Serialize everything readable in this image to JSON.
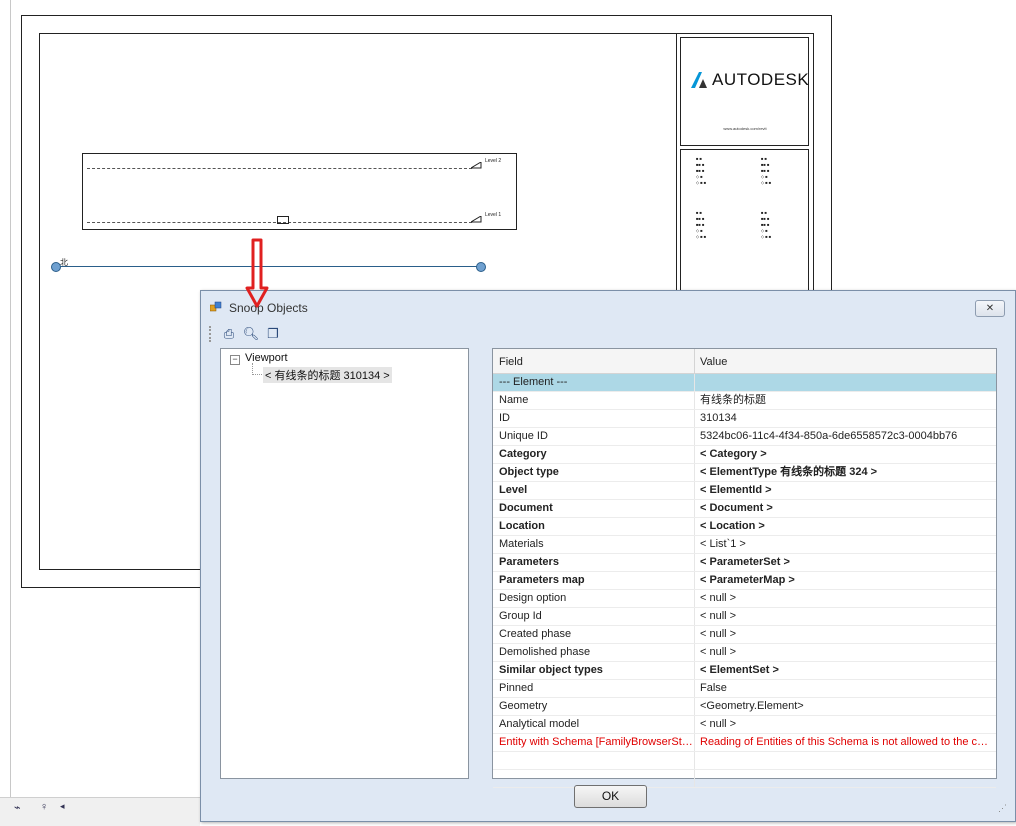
{
  "background": {
    "logo_text": "AUTODESK",
    "logo_url": "www.autodesk.com/revit",
    "grid_label": "北",
    "level_top": "Level 2",
    "level_bottom": "Level 1"
  },
  "dialog": {
    "title": "Snoop Objects",
    "close_label": "✕",
    "ok_label": "OK",
    "tree": {
      "root": "Viewport",
      "child": "< 有线条的标题  310134 >"
    },
    "grid": {
      "columns": [
        "Field",
        "Value"
      ],
      "rows": [
        {
          "field": "--- Element ---",
          "value": "",
          "style": "section"
        },
        {
          "field": "Name",
          "value": "有线条的标题",
          "style": "normal"
        },
        {
          "field": "ID",
          "value": "310134",
          "style": "normal"
        },
        {
          "field": "Unique ID",
          "value": "5324bc06-11c4-4f34-850a-6de6558572c3-0004bb76",
          "style": "normal"
        },
        {
          "field": "Category",
          "value": "< Category >",
          "style": "bold"
        },
        {
          "field": "Object type",
          "value": "< ElementType  有线条的标题    324 >",
          "style": "bold"
        },
        {
          "field": "Level",
          "value": "< ElementId >",
          "style": "bold"
        },
        {
          "field": "Document",
          "value": "< Document >",
          "style": "bold"
        },
        {
          "field": "Location",
          "value": "< Location >",
          "style": "bold"
        },
        {
          "field": "Materials",
          "value": "< List`1 >",
          "style": "normal"
        },
        {
          "field": "Parameters",
          "value": "< ParameterSet >",
          "style": "bold"
        },
        {
          "field": "Parameters map",
          "value": "< ParameterMap >",
          "style": "bold"
        },
        {
          "field": "Design option",
          "value": "< null >",
          "style": "normal"
        },
        {
          "field": "Group Id",
          "value": "< null >",
          "style": "normal"
        },
        {
          "field": "Created phase",
          "value": "< null >",
          "style": "normal"
        },
        {
          "field": "Demolished phase",
          "value": "< null >",
          "style": "normal"
        },
        {
          "field": "Similar object types",
          "value": "< ElementSet >",
          "style": "bold"
        },
        {
          "field": "Pinned",
          "value": "False",
          "style": "normal"
        },
        {
          "field": "Geometry",
          "value": "<Geometry.Element>",
          "style": "normal"
        },
        {
          "field": "Analytical model",
          "value": "< null >",
          "style": "normal"
        },
        {
          "field": "Entity with Schema [FamilyBrowserStat...",
          "value": "Reading of Entities of this Schema is not allowed to the cur...",
          "style": "error"
        },
        {
          "field": "",
          "value": "",
          "style": "normal"
        },
        {
          "field": "",
          "value": "",
          "style": "normal"
        }
      ]
    }
  },
  "colors": {
    "section_row": "#add8e6",
    "error_text": "#e00000",
    "arrow": "#e02020",
    "grid_line": "#2a5e8a"
  }
}
